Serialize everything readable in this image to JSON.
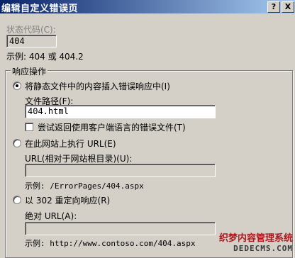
{
  "window": {
    "title": "编辑自定义错误页",
    "help_button": "?",
    "close_button": "X"
  },
  "status_code": {
    "label": "状态代码(C):",
    "value": "404",
    "example": "示例: 404 或 404.2"
  },
  "response_action": {
    "group_label": "响应操作",
    "option_static": {
      "label": "将静态文件中的内容插入错误响应中(I)",
      "path_label": "文件路径(F):",
      "path_value": "404.html",
      "localized_label": "尝试返回使用客户端语言的错误文件(T)"
    },
    "option_execute": {
      "label": "在此网站上执行 URL(E)",
      "url_label": "URL(相对于网站根目录)(U):",
      "url_value": "",
      "example": "示例: /ErrorPages/404.aspx"
    },
    "option_redirect": {
      "label": "以 302 重定向响应(R)",
      "url_label": "绝对 URL(A):",
      "url_value": "",
      "example": "示例: http://www.contoso.com/404.aspx"
    }
  },
  "watermark": {
    "line1": "织梦内容管理系统",
    "line2": "DEDECMS.COM"
  }
}
